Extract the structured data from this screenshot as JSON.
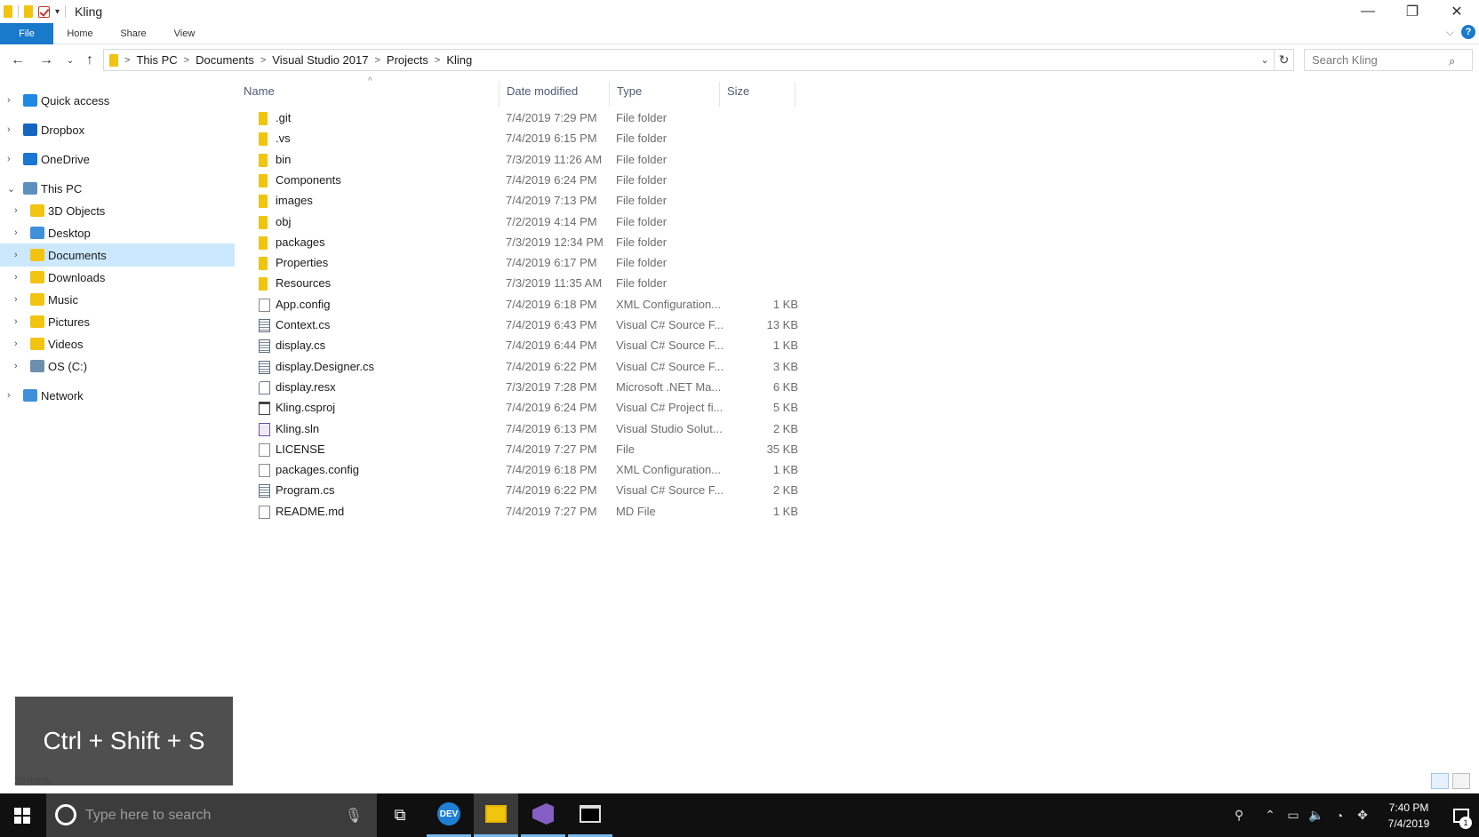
{
  "window": {
    "title": "Kling",
    "controls": {
      "minimize": "—",
      "maximize": "❐",
      "close": "✕"
    }
  },
  "ribbon": {
    "tabs": [
      "File",
      "Home",
      "Share",
      "View"
    ]
  },
  "address": {
    "breadcrumbs": [
      "This PC",
      "Documents",
      "Visual Studio 2017",
      "Projects",
      "Kling"
    ]
  },
  "search": {
    "placeholder": "Search Kling"
  },
  "nav_pane": {
    "items": [
      {
        "label": "Quick access",
        "icon": "star-icon",
        "color": "#1e88e5",
        "level": 0
      },
      {
        "label": "Dropbox",
        "icon": "dropbox-icon",
        "color": "#1565c0",
        "level": 0
      },
      {
        "label": "OneDrive",
        "icon": "onedrive-icon",
        "color": "#1976d2",
        "level": 0
      },
      {
        "label": "This PC",
        "icon": "computer-icon",
        "color": "#5d8fbf",
        "level": 0,
        "expanded": true
      },
      {
        "label": "3D Objects",
        "icon": "3d-objects-icon",
        "color": "#f1c40f",
        "level": 1
      },
      {
        "label": "Desktop",
        "icon": "desktop-icon",
        "color": "#3f8fdb",
        "level": 1
      },
      {
        "label": "Documents",
        "icon": "documents-icon",
        "color": "#f1c40f",
        "level": 1,
        "selected": true
      },
      {
        "label": "Downloads",
        "icon": "downloads-icon",
        "color": "#f1c40f",
        "level": 1
      },
      {
        "label": "Music",
        "icon": "music-icon",
        "color": "#f1c40f",
        "level": 1
      },
      {
        "label": "Pictures",
        "icon": "pictures-icon",
        "color": "#f1c40f",
        "level": 1
      },
      {
        "label": "Videos",
        "icon": "videos-icon",
        "color": "#f1c40f",
        "level": 1
      },
      {
        "label": "OS (C:)",
        "icon": "drive-icon",
        "color": "#6c8fad",
        "level": 1
      },
      {
        "label": "Network",
        "icon": "network-icon",
        "color": "#3f8fdb",
        "level": 0
      }
    ]
  },
  "columns": {
    "name": "Name",
    "date": "Date modified",
    "type": "Type",
    "size": "Size"
  },
  "files": [
    {
      "name": ".git",
      "date": "7/4/2019 7:29 PM",
      "type": "File folder",
      "size": "",
      "icon": "folder-icon"
    },
    {
      "name": ".vs",
      "date": "7/4/2019 6:15 PM",
      "type": "File folder",
      "size": "",
      "icon": "folder-icon"
    },
    {
      "name": "bin",
      "date": "7/3/2019 11:26 AM",
      "type": "File folder",
      "size": "",
      "icon": "folder-icon"
    },
    {
      "name": "Components",
      "date": "7/4/2019 6:24 PM",
      "type": "File folder",
      "size": "",
      "icon": "folder-icon"
    },
    {
      "name": "images",
      "date": "7/4/2019 7:13 PM",
      "type": "File folder",
      "size": "",
      "icon": "folder-icon"
    },
    {
      "name": "obj",
      "date": "7/2/2019 4:14 PM",
      "type": "File folder",
      "size": "",
      "icon": "folder-icon"
    },
    {
      "name": "packages",
      "date": "7/3/2019 12:34 PM",
      "type": "File folder",
      "size": "",
      "icon": "folder-icon"
    },
    {
      "name": "Properties",
      "date": "7/4/2019 6:17 PM",
      "type": "File folder",
      "size": "",
      "icon": "folder-icon"
    },
    {
      "name": "Resources",
      "date": "7/3/2019 11:35 AM",
      "type": "File folder",
      "size": "",
      "icon": "folder-icon"
    },
    {
      "name": "App.config",
      "date": "7/4/2019 6:18 PM",
      "type": "XML Configuration...",
      "size": "1 KB",
      "icon": "config-file-icon"
    },
    {
      "name": "Context.cs",
      "date": "7/4/2019 6:43 PM",
      "type": "Visual C# Source F...",
      "size": "13 KB",
      "icon": "csharp-file-icon"
    },
    {
      "name": "display.cs",
      "date": "7/4/2019 6:44 PM",
      "type": "Visual C# Source F...",
      "size": "1 KB",
      "icon": "csharp-file-icon"
    },
    {
      "name": "display.Designer.cs",
      "date": "7/4/2019 6:22 PM",
      "type": "Visual C# Source F...",
      "size": "3 KB",
      "icon": "csharp-file-icon"
    },
    {
      "name": "display.resx",
      "date": "7/3/2019 7:28 PM",
      "type": "Microsoft .NET Ma...",
      "size": "6 KB",
      "icon": "resx-file-icon"
    },
    {
      "name": "Kling.csproj",
      "date": "7/4/2019 6:24 PM",
      "type": "Visual C# Project fi...",
      "size": "5 KB",
      "icon": "csproj-file-icon"
    },
    {
      "name": "Kling.sln",
      "date": "7/4/2019 6:13 PM",
      "type": "Visual Studio Solut...",
      "size": "2 KB",
      "icon": "sln-file-icon"
    },
    {
      "name": "LICENSE",
      "date": "7/4/2019 7:27 PM",
      "type": "File",
      "size": "35 KB",
      "icon": "generic-file-icon"
    },
    {
      "name": "packages.config",
      "date": "7/4/2019 6:18 PM",
      "type": "XML Configuration...",
      "size": "1 KB",
      "icon": "config-file-icon"
    },
    {
      "name": "Program.cs",
      "date": "7/4/2019 6:22 PM",
      "type": "Visual C# Source F...",
      "size": "2 KB",
      "icon": "csharp-file-icon"
    },
    {
      "name": "README.md",
      "date": "7/4/2019 7:27 PM",
      "type": "MD File",
      "size": "1 KB",
      "icon": "generic-file-icon"
    }
  ],
  "status": {
    "items": "20 items"
  },
  "shortcut_overlay": {
    "text": "Ctrl + Shift + S"
  },
  "taskbar": {
    "search_placeholder": "Type here to search",
    "time": "7:40 PM",
    "date": "7/4/2019",
    "notification_count": "1",
    "edge_label": "DEV"
  },
  "colors": {
    "accent": "#1979ca",
    "selection": "#cce8ff",
    "folder": "#f1c40f",
    "taskbar": "#101010"
  }
}
